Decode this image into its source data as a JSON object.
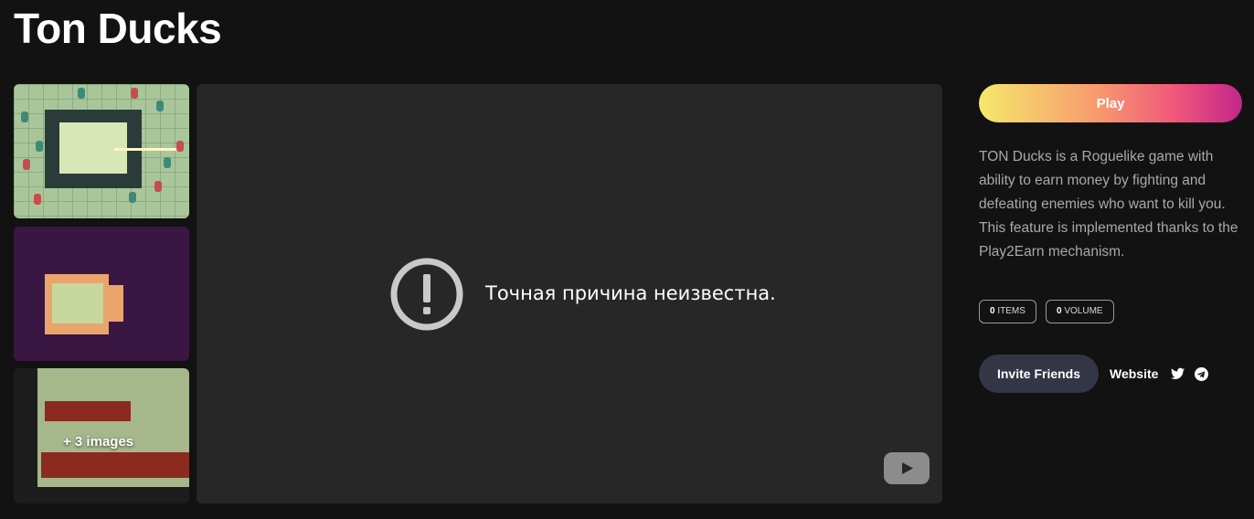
{
  "page": {
    "title": "Ton Ducks"
  },
  "gallery": {
    "more_images_label": "+ 3 images"
  },
  "video": {
    "error_text": "Точная причина неизвестна.",
    "error_icon": "exclamation-circle-icon",
    "play_icon": "youtube-play-icon"
  },
  "sidebar": {
    "play_label": "Play",
    "description": "TON Ducks is a Roguelike game with ability to earn money by fighting and defeating enemies who want to kill you. This feature is implemented thanks to the Play2Earn mechanism.",
    "stats": [
      {
        "value": "0",
        "label": "ITEMS"
      },
      {
        "value": "0",
        "label": "VOLUME"
      }
    ],
    "invite_label": "Invite Friends",
    "website_label": "Website",
    "social_icons": [
      "twitter-icon",
      "telegram-icon"
    ]
  },
  "colors": {
    "background": "#121212",
    "play_gradient": [
      "#f6e86c",
      "#f0567a",
      "#c2268a"
    ],
    "invite_button": "#333645",
    "description_text": "#a9a9ad"
  }
}
